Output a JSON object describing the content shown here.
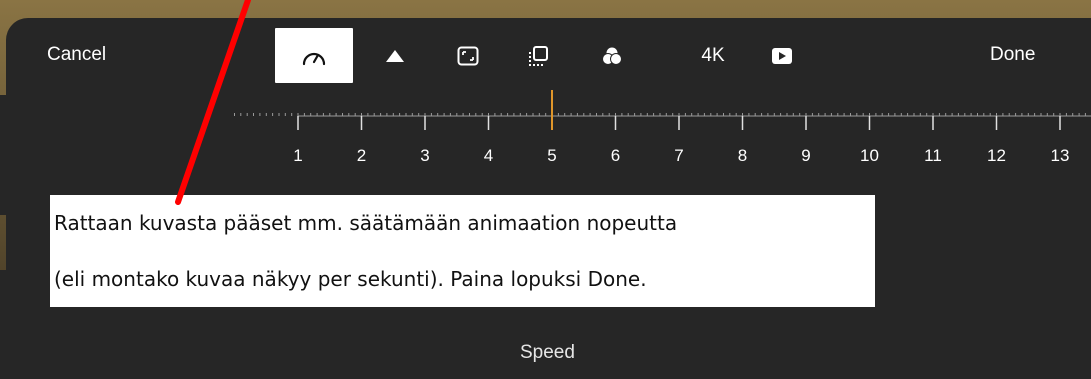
{
  "toolbar": {
    "cancel_label": "Cancel",
    "done_label": "Done",
    "resolution_label": "4K",
    "tools": [
      {
        "icon": "speedometer-icon",
        "active": true
      },
      {
        "icon": "triangle-up-icon",
        "active": false
      },
      {
        "icon": "frame-icon",
        "active": false
      },
      {
        "icon": "onion-skin-icon",
        "active": false
      },
      {
        "icon": "color-filter-icon",
        "active": false
      },
      {
        "icon": "play-icon",
        "active": false
      }
    ]
  },
  "speed_ruler": {
    "labels": [
      "1",
      "2",
      "3",
      "4",
      "5",
      "6",
      "7",
      "8",
      "9",
      "10",
      "11",
      "12",
      "13"
    ],
    "selected_value": 5,
    "accent_color": "#e0962a"
  },
  "callout": {
    "line1": "Rattaan kuvasta pääset mm. säätämään animaation nopeutta",
    "line2_prefix": "(eli montako kuvaa näkyy per sekunti). Paina lopuksi ",
    "line2_done": "Done",
    "line2_suffix": "."
  },
  "footer": {
    "caption": "Speed"
  },
  "colors": {
    "panel_bg": "#262626",
    "annotation_arrow": "#ff0000"
  }
}
